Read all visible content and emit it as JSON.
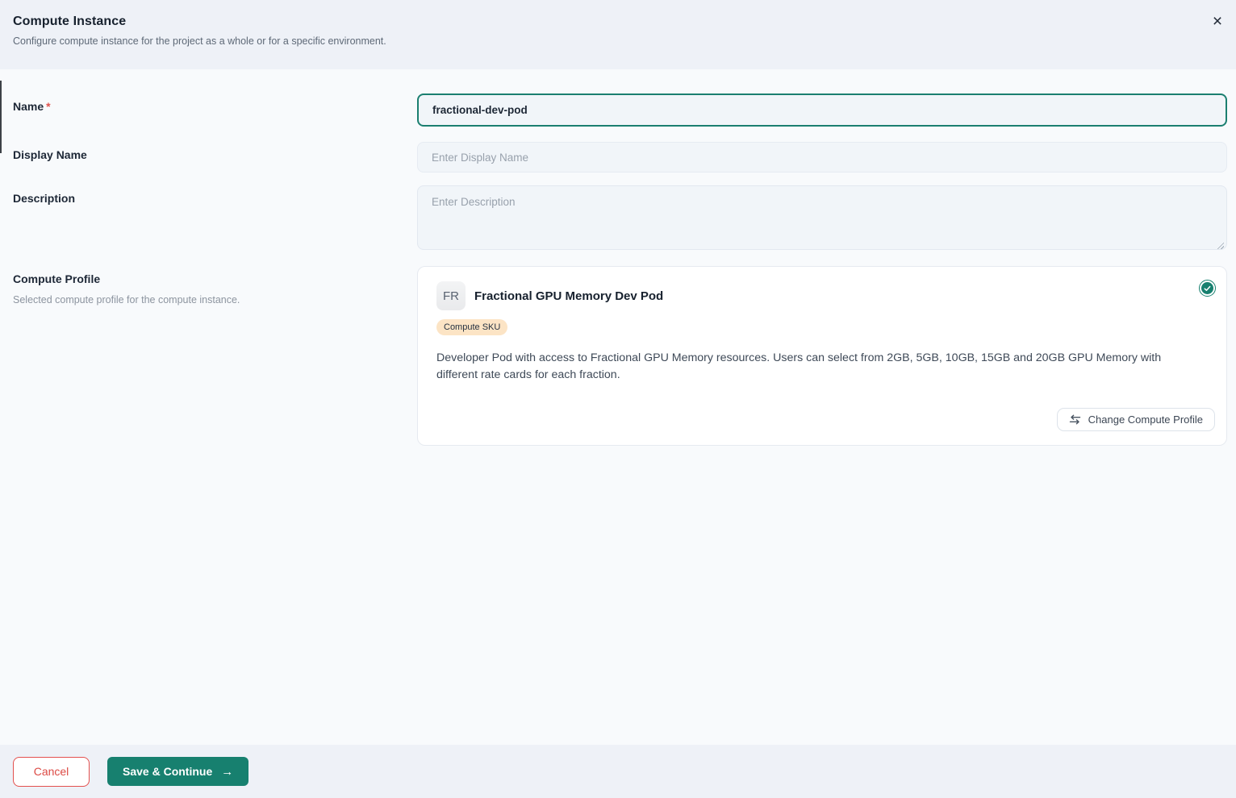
{
  "header": {
    "title": "Compute Instance",
    "subtitle": "Configure compute instance for the project as a whole or for a specific environment."
  },
  "form": {
    "name": {
      "label": "Name",
      "required_marker": "*",
      "value": "fractional-dev-pod"
    },
    "display_name": {
      "label": "Display Name",
      "placeholder": "Enter Display Name"
    },
    "description": {
      "label": "Description",
      "placeholder": "Enter Description"
    },
    "compute_profile": {
      "label": "Compute Profile",
      "help_text": "Selected compute profile for the compute instance.",
      "card": {
        "avatar_initials": "FR",
        "title": "Fractional GPU Memory Dev Pod",
        "badge": "Compute SKU",
        "description": "Developer Pod with access to Fractional GPU Memory resources. Users can select from 2GB, 5GB, 10GB, 15GB and 20GB GPU Memory with different rate cards for each fraction.",
        "selected": true,
        "change_button_label": "Change Compute Profile"
      }
    }
  },
  "footer": {
    "cancel_label": "Cancel",
    "save_label": "Save & Continue"
  },
  "icons": {
    "close": "×",
    "arrow_right": "→"
  },
  "colors": {
    "accent_teal": "#17806F",
    "danger_red": "#E3504E",
    "badge_bg": "#FCE4C5",
    "header_bg": "#EEF1F7",
    "main_bg": "#F8FAFC"
  }
}
